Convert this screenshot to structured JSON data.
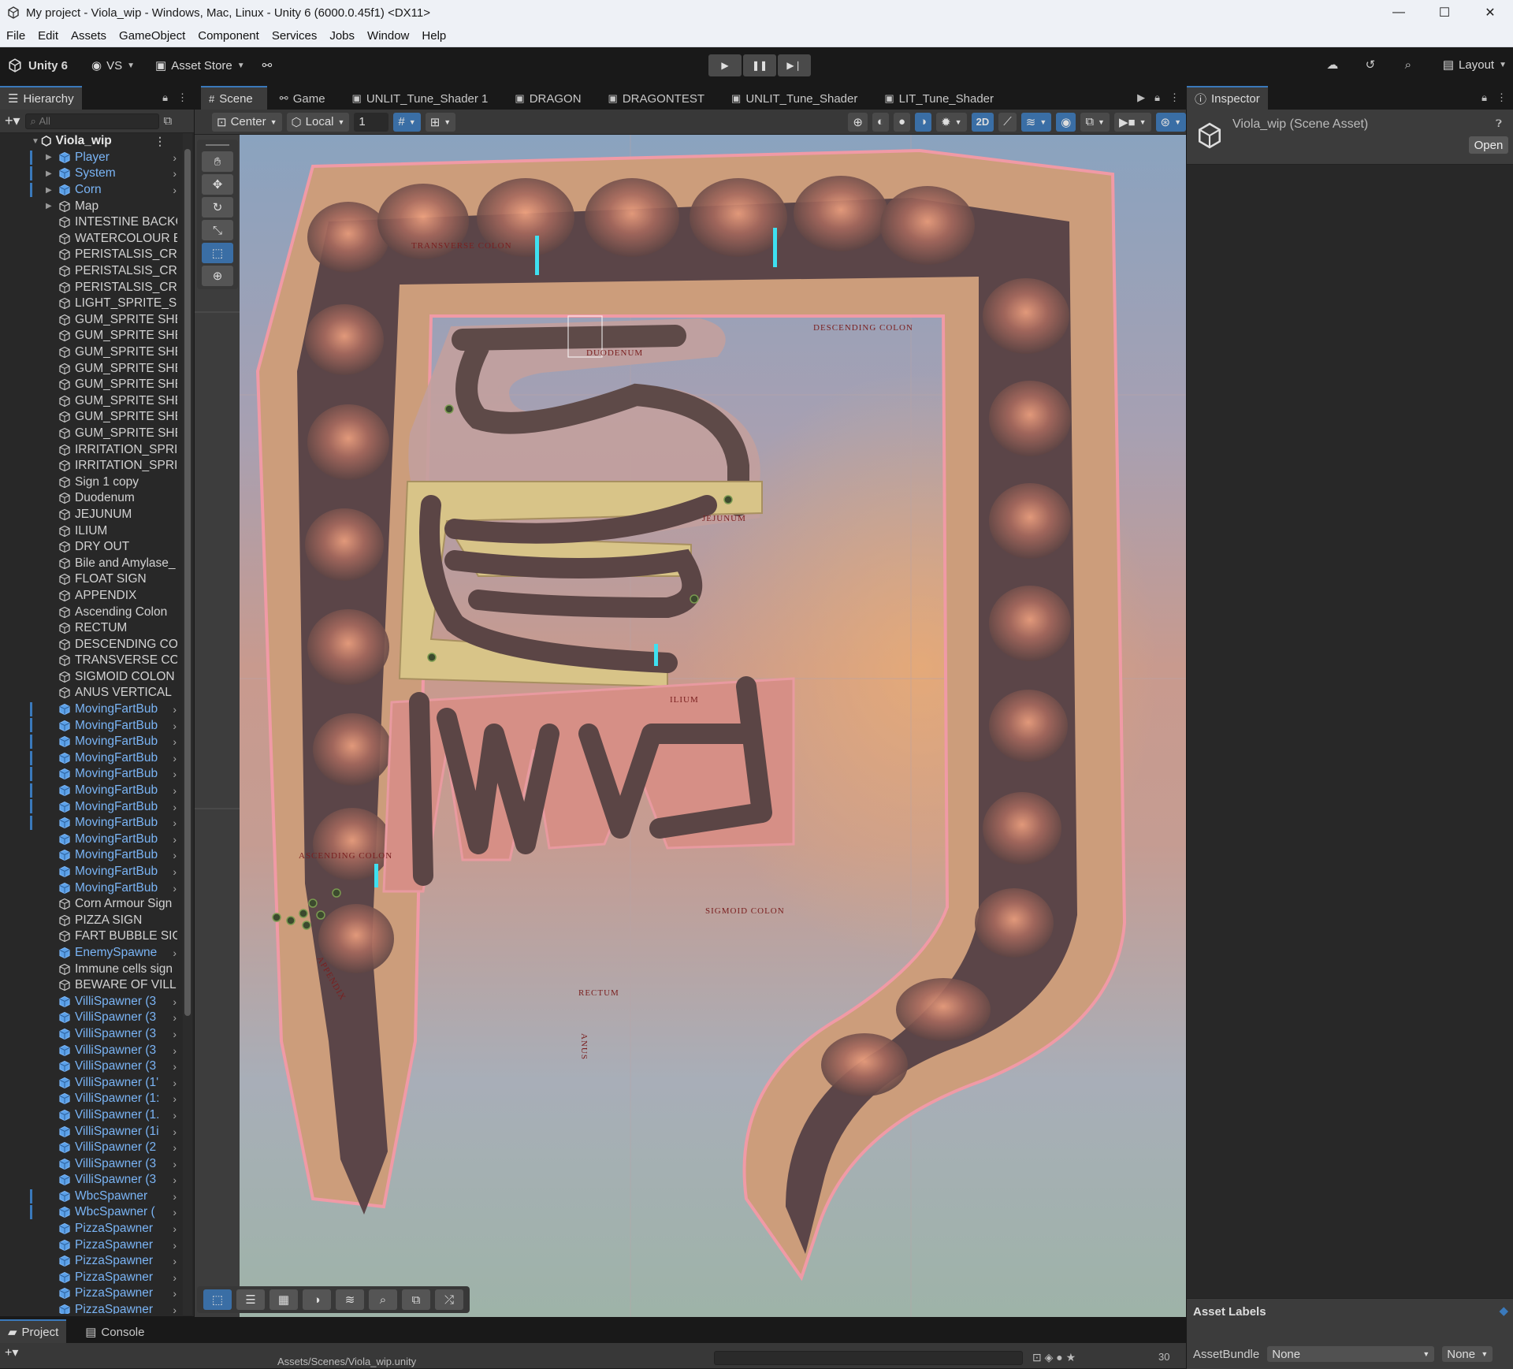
{
  "window": {
    "title": "My project - Viola_wip - Windows, Mac, Linux - Unity 6 (6000.0.45f1) <DX11>",
    "min": "—",
    "max": "☐",
    "close": "✕"
  },
  "menu": [
    "File",
    "Edit",
    "Assets",
    "GameObject",
    "Component",
    "Services",
    "Jobs",
    "Window",
    "Help"
  ],
  "toolbar": {
    "unity": "Unity 6",
    "vs": "VS",
    "asset_store": "Asset Store",
    "layout": "Layout"
  },
  "hierarchy": {
    "tab": "Hierarchy",
    "search_placeholder": "All",
    "scene_name": "Viola_wip",
    "items": [
      {
        "name": "Player",
        "prefab": true,
        "arrow": true,
        "mark": true
      },
      {
        "name": "System",
        "prefab": true,
        "arrow": true,
        "mark": true
      },
      {
        "name": "Corn",
        "prefab": true,
        "arrow": true,
        "mark": true
      },
      {
        "name": "Map",
        "prefab": false,
        "arrow": true,
        "mark": false
      },
      {
        "name": "INTESTINE BACKG",
        "prefab": false
      },
      {
        "name": "WATERCOLOUR B",
        "prefab": false
      },
      {
        "name": "PERISTALSIS_CRU",
        "prefab": false
      },
      {
        "name": "PERISTALSIS_CRU",
        "prefab": false
      },
      {
        "name": "PERISTALSIS_CRU",
        "prefab": false
      },
      {
        "name": "LIGHT_SPRITE_SH",
        "prefab": false
      },
      {
        "name": "GUM_SPRITE SHE",
        "prefab": false
      },
      {
        "name": "GUM_SPRITE SHE",
        "prefab": false
      },
      {
        "name": "GUM_SPRITE SHE",
        "prefab": false
      },
      {
        "name": "GUM_SPRITE SHE",
        "prefab": false
      },
      {
        "name": "GUM_SPRITE SHE",
        "prefab": false
      },
      {
        "name": "GUM_SPRITE SHE",
        "prefab": false
      },
      {
        "name": "GUM_SPRITE SHE",
        "prefab": false
      },
      {
        "name": "GUM_SPRITE SHE",
        "prefab": false
      },
      {
        "name": "IRRITATION_SPRIT",
        "prefab": false
      },
      {
        "name": "IRRITATION_SPRIT",
        "prefab": false
      },
      {
        "name": "Sign 1 copy",
        "prefab": false
      },
      {
        "name": "Duodenum",
        "prefab": false
      },
      {
        "name": "JEJUNUM",
        "prefab": false
      },
      {
        "name": "ILIUM",
        "prefab": false
      },
      {
        "name": "DRY OUT",
        "prefab": false
      },
      {
        "name": "Bile and Amylase_",
        "prefab": false
      },
      {
        "name": "FLOAT SIGN",
        "prefab": false
      },
      {
        "name": "APPENDIX",
        "prefab": false
      },
      {
        "name": "Ascending Colon",
        "prefab": false
      },
      {
        "name": "RECTUM",
        "prefab": false
      },
      {
        "name": "DESCENDING CO",
        "prefab": false
      },
      {
        "name": "TRANSVERSE CO",
        "prefab": false
      },
      {
        "name": "SIGMOID COLON",
        "prefab": false
      },
      {
        "name": "ANUS VERTICAL",
        "prefab": false
      },
      {
        "name": "MovingFartBub",
        "prefab": true,
        "more": true,
        "mark": true
      },
      {
        "name": "MovingFartBub",
        "prefab": true,
        "more": true,
        "mark": true
      },
      {
        "name": "MovingFartBub",
        "prefab": true,
        "more": true,
        "mark": true
      },
      {
        "name": "MovingFartBub",
        "prefab": true,
        "more": true,
        "mark": true
      },
      {
        "name": "MovingFartBub",
        "prefab": true,
        "more": true,
        "mark": true
      },
      {
        "name": "MovingFartBub",
        "prefab": true,
        "more": true,
        "mark": true
      },
      {
        "name": "MovingFartBub",
        "prefab": true,
        "more": true,
        "mark": true
      },
      {
        "name": "MovingFartBub",
        "prefab": true,
        "more": true,
        "mark": true
      },
      {
        "name": "MovingFartBub",
        "prefab": true,
        "more": true
      },
      {
        "name": "MovingFartBub",
        "prefab": true,
        "more": true
      },
      {
        "name": "MovingFartBub",
        "prefab": true,
        "more": true
      },
      {
        "name": "MovingFartBub",
        "prefab": true,
        "more": true
      },
      {
        "name": "Corn Armour Sign",
        "prefab": false
      },
      {
        "name": "PIZZA SIGN",
        "prefab": false
      },
      {
        "name": "FART BUBBLE SIG",
        "prefab": false
      },
      {
        "name": "EnemySpawne",
        "prefab": true,
        "more": true
      },
      {
        "name": "Immune cells sign",
        "prefab": false
      },
      {
        "name": "BEWARE OF VILLI",
        "prefab": false
      },
      {
        "name": "VilliSpawner (3",
        "prefab": true,
        "more": true
      },
      {
        "name": "VilliSpawner (3",
        "prefab": true,
        "more": true
      },
      {
        "name": "VilliSpawner (3",
        "prefab": true,
        "more": true
      },
      {
        "name": "VilliSpawner (3",
        "prefab": true,
        "more": true
      },
      {
        "name": "VilliSpawner (3",
        "prefab": true,
        "more": true
      },
      {
        "name": "VilliSpawner (1'",
        "prefab": true,
        "more": true
      },
      {
        "name": "VilliSpawner (1:",
        "prefab": true,
        "more": true
      },
      {
        "name": "VilliSpawner (1.",
        "prefab": true,
        "more": true
      },
      {
        "name": "VilliSpawner (1i",
        "prefab": true,
        "more": true
      },
      {
        "name": "VilliSpawner (2",
        "prefab": true,
        "more": true
      },
      {
        "name": "VilliSpawner (3",
        "prefab": true,
        "more": true
      },
      {
        "name": "VilliSpawner (3",
        "prefab": true,
        "more": true
      },
      {
        "name": "WbcSpawner",
        "prefab": true,
        "more": true,
        "mark": true
      },
      {
        "name": "WbcSpawner (",
        "prefab": true,
        "more": true,
        "mark": true
      },
      {
        "name": "PizzaSpawner",
        "prefab": true,
        "more": true
      },
      {
        "name": "PizzaSpawner",
        "prefab": true,
        "more": true
      },
      {
        "name": "PizzaSpawner",
        "prefab": true,
        "more": true
      },
      {
        "name": "PizzaSpawner",
        "prefab": true,
        "more": true
      },
      {
        "name": "PizzaSpawner",
        "prefab": true,
        "more": true
      },
      {
        "name": "PizzaSpawner",
        "prefab": true,
        "more": true
      },
      {
        "name": "PizzaSpawner",
        "prefab": true,
        "more": true
      }
    ]
  },
  "scene": {
    "tabs": [
      "Scene",
      "Game",
      "UNLIT_Tune_Shader 1",
      "DRAGON",
      "DRAGONTEST",
      "UNLIT_Tune_Shader",
      "LIT_Tune_Shader"
    ],
    "pivot": "Center",
    "space": "Local",
    "grid_value": "1",
    "mode2d": "2D",
    "map_labels": {
      "transverse": "TRANSVERSE COLON",
      "descending": "DESCENDING COLON",
      "duodenum": "DUODENUM",
      "jejunum": "JEJUNUM",
      "ilium": "ILIUM",
      "ascending": "ASCENDING COLON",
      "appendix": "APPENDIX",
      "sigmoid": "SIGMOID COLON",
      "rectum": "RECTUM",
      "anus": "ANUS"
    }
  },
  "inspector": {
    "tab": "Inspector",
    "title": "Viola_wip (Scene Asset)",
    "open": "Open",
    "asset_labels": "Asset Labels",
    "asset_bundle": "AssetBundle",
    "bundle_value": "None",
    "variant_value": "None"
  },
  "bottom": {
    "tabs": [
      "Project",
      "Console"
    ],
    "path": "Assets/Scenes/Viola_wip.unity",
    "count": "30"
  }
}
